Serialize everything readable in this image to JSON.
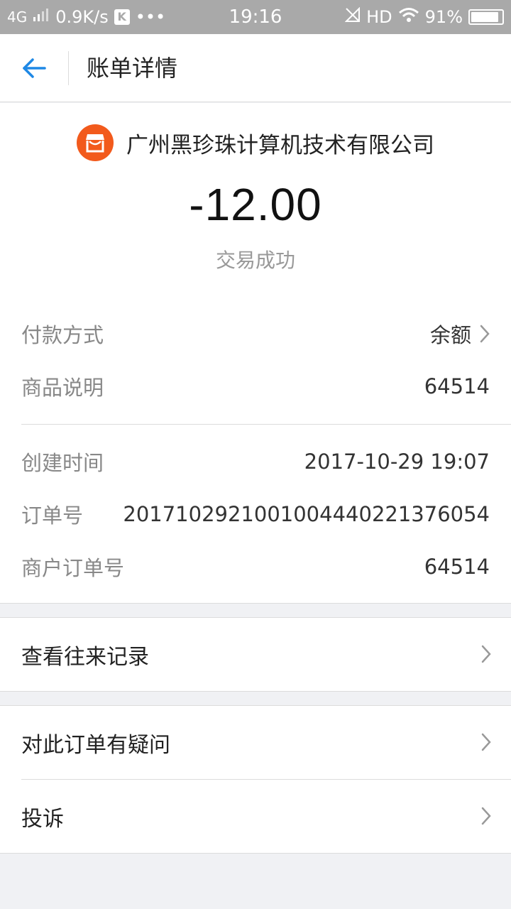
{
  "status_bar": {
    "network": "4G",
    "speed": "0.9K/s",
    "k_badge": "K",
    "dots": "•••",
    "time": "19:16",
    "hd": "HD",
    "battery": "91%",
    "battery_level": 0.91
  },
  "header": {
    "title": "账单详情"
  },
  "merchant": {
    "name": "广州黑珍珠计算机技术有限公司",
    "logo_color": "#f25a1c"
  },
  "transaction": {
    "amount": "-12.00",
    "status": "交易成功"
  },
  "details": [
    {
      "label": "付款方式",
      "value": "余额",
      "has_arrow": true
    },
    {
      "label": "商品说明",
      "value": "64514"
    },
    {
      "label": "创建时间",
      "value": "2017-10-29 19:07"
    },
    {
      "label": "订单号",
      "value": "2017102921001004440221376054"
    },
    {
      "label": "商户订单号",
      "value": "64514"
    }
  ],
  "actions": {
    "history": "查看往来记录",
    "question": "对此订单有疑问",
    "complaint": "投诉"
  },
  "colors": {
    "accent": "#1e88e5",
    "status_bar": "#a9a9a9",
    "background": "#f0f1f4"
  }
}
